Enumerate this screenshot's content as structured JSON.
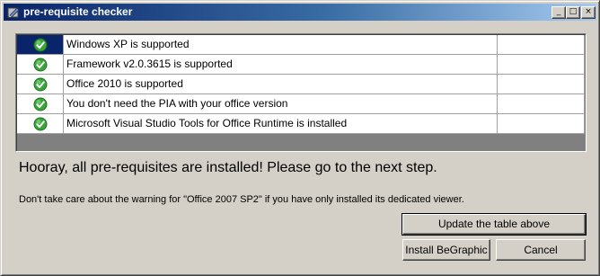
{
  "window": {
    "title": "pre-requisite checker",
    "caption_buttons": {
      "minimize": "_",
      "maximize": "□",
      "close": "×"
    }
  },
  "table": {
    "rows": [
      {
        "status": "check-icon",
        "text": "Windows XP is supported",
        "extra": "",
        "selected": true
      },
      {
        "status": "check-icon",
        "text": "Framework v2.0.3615 is supported",
        "extra": ""
      },
      {
        "status": "check-icon",
        "text": "Office 2010 is supported",
        "extra": ""
      },
      {
        "status": "check-icon",
        "text": "You don't need the PIA with your office version",
        "extra": ""
      },
      {
        "status": "check-icon",
        "text": "Microsoft Visual Studio Tools for Office Runtime is installed",
        "extra": ""
      }
    ]
  },
  "status_message": "Hooray, all pre-requisites are installed! Please go to the next step.",
  "note": "Don't take care about the warning for \"Office 2007 SP2\" if you have only installed its dedicated viewer.",
  "buttons": {
    "update": "Update the table above",
    "install": "Install BeGraphic",
    "cancel": "Cancel"
  },
  "colors": {
    "selection": "#0a246a",
    "check_green": "#3aa63a",
    "title_start": "#0a246a",
    "title_end": "#a6caf0"
  }
}
